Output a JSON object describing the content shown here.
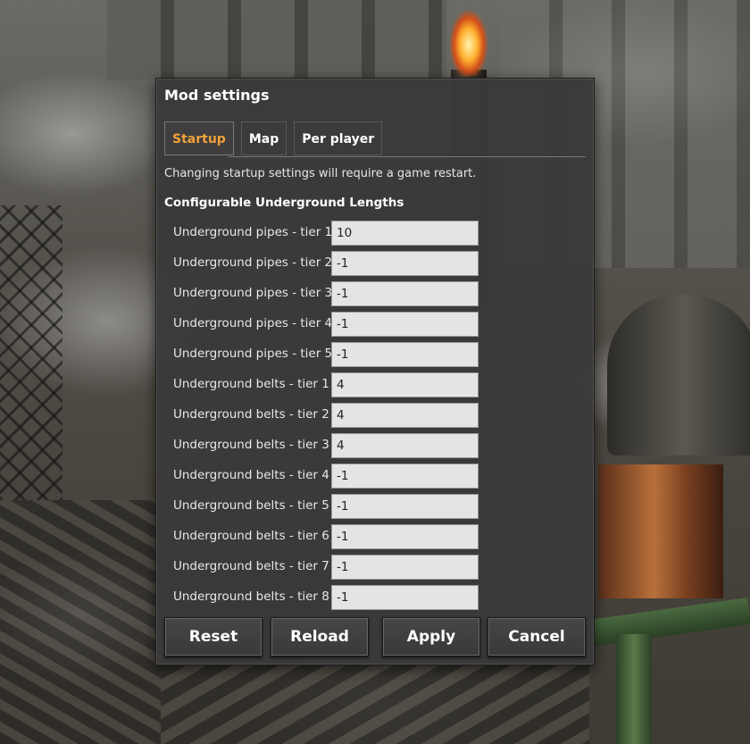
{
  "dialog": {
    "title": "Mod settings",
    "tabs": [
      {
        "label": "Startup",
        "active": true
      },
      {
        "label": "Map",
        "active": false
      },
      {
        "label": "Per player",
        "active": false
      }
    ],
    "note": "Changing startup settings will require a game restart.",
    "section_title": "Configurable Underground Lengths",
    "settings": [
      {
        "label": "Underground pipes - tier 1",
        "value": "10"
      },
      {
        "label": "Underground pipes - tier 2",
        "value": "-1"
      },
      {
        "label": "Underground pipes - tier 3",
        "value": "-1"
      },
      {
        "label": "Underground pipes - tier 4",
        "value": "-1"
      },
      {
        "label": "Underground pipes - tier 5",
        "value": "-1"
      },
      {
        "label": "Underground belts - tier 1",
        "value": "4"
      },
      {
        "label": "Underground belts - tier 2",
        "value": "4"
      },
      {
        "label": "Underground belts - tier 3",
        "value": "4"
      },
      {
        "label": "Underground belts - tier 4",
        "value": "-1"
      },
      {
        "label": "Underground belts - tier 5",
        "value": "-1"
      },
      {
        "label": "Underground belts - tier 6",
        "value": "-1"
      },
      {
        "label": "Underground belts - tier 7",
        "value": "-1"
      },
      {
        "label": "Underground belts - tier 8",
        "value": "-1"
      }
    ],
    "buttons": {
      "reset": "Reset",
      "reload": "Reload",
      "apply": "Apply",
      "cancel": "Cancel"
    }
  },
  "colors": {
    "active_tab": "#f0a13b",
    "panel": "#3a393a",
    "field": "#e4e4e4"
  }
}
